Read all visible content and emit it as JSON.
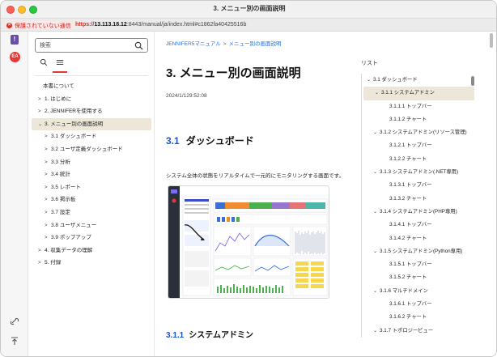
{
  "window": {
    "title": "3. メニュー別の画面説明"
  },
  "urlbar": {
    "security_label": "保護されていない通信",
    "scheme": "https://",
    "host": "13.113.18.12",
    "path": ":8443/manual/ja/index.html#c1862fa40425516b"
  },
  "rail": {
    "warn_glyph": "!",
    "avatar_text": "EA"
  },
  "nav": {
    "search_placeholder": "検索",
    "toc": [
      {
        "label": "本書について",
        "level": "plain",
        "chevron": ""
      },
      {
        "label": "1. はじめに",
        "level": "l0",
        "chevron": ">"
      },
      {
        "label": "2. JENNIFERを使用する",
        "level": "l0",
        "chevron": ">"
      },
      {
        "label": "3. メニュー別の画面説明",
        "level": "l0",
        "chevron": "⌄",
        "active": true
      },
      {
        "label": "3.1 ダッシュボード",
        "level": "l1",
        "chevron": ">"
      },
      {
        "label": "3.2 ユーザ定義ダッシュボード",
        "level": "l1",
        "chevron": ">"
      },
      {
        "label": "3.3 分析",
        "level": "l1",
        "chevron": ">"
      },
      {
        "label": "3.4 統計",
        "level": "l1",
        "chevron": ">"
      },
      {
        "label": "3.5 レポート",
        "level": "l1",
        "chevron": ">"
      },
      {
        "label": "3.6 掲示板",
        "level": "l1",
        "chevron": ">"
      },
      {
        "label": "3.7 設定",
        "level": "l1",
        "chevron": ">"
      },
      {
        "label": "3.8 ユーザメニュー",
        "level": "l1",
        "chevron": ">"
      },
      {
        "label": "3.9 ポップアップ",
        "level": "l1",
        "chevron": ">"
      },
      {
        "label": "4. 収集データの理解",
        "level": "l0",
        "chevron": ">"
      },
      {
        "label": "5. 付録",
        "level": "l0",
        "chevron": ">"
      }
    ]
  },
  "main": {
    "breadcrumb": [
      "JENNIFER5マニュアル",
      "メニュー別の画面説明"
    ],
    "breadcrumb_sep": ">",
    "title": "3.  メニュー別の画面説明",
    "date": "2024/1/129:52:08",
    "section_num": "3.1",
    "section_title": "ダッシュボード",
    "description": "システム全体の状態をリアルタイムで一元的にモニタリングする画面です。",
    "subsection_num": "3.1.1",
    "subsection_title": "システムアドミン"
  },
  "rlist": {
    "title": "リスト",
    "items": [
      {
        "label": "3.1 ダッシュボード",
        "depth": "d0",
        "chevron": "⌄"
      },
      {
        "label": "3.1.1 システムアドミン",
        "depth": "d1",
        "chevron": "⌄",
        "active": true
      },
      {
        "label": "3.1.1.1 トップバー",
        "depth": "d2",
        "chevron": ""
      },
      {
        "label": "3.1.1.2 チャート",
        "depth": "d2",
        "chevron": ""
      },
      {
        "label": "3.1.2 システムアドミン(リソース管理)",
        "depth": "d1",
        "chevron": "⌄"
      },
      {
        "label": "3.1.2.1 トップバー",
        "depth": "d2",
        "chevron": ""
      },
      {
        "label": "3.1.2.2 チャート",
        "depth": "d2",
        "chevron": ""
      },
      {
        "label": "3.1.3 システムアドミン(.NET専用)",
        "depth": "d1",
        "chevron": "⌄"
      },
      {
        "label": "3.1.3.1 トップバー",
        "depth": "d2",
        "chevron": ""
      },
      {
        "label": "3.1.3.2 チャート",
        "depth": "d2",
        "chevron": ""
      },
      {
        "label": "3.1.4 システムアドミン(PHP専用)",
        "depth": "d1",
        "chevron": "⌄"
      },
      {
        "label": "3.1.4.1 トップバー",
        "depth": "d2",
        "chevron": ""
      },
      {
        "label": "3.1.4.2 チャート",
        "depth": "d2",
        "chevron": ""
      },
      {
        "label": "3.1.5 システムアドミン(Python専用)",
        "depth": "d1",
        "chevron": "⌄"
      },
      {
        "label": "3.1.5.1 トップバー",
        "depth": "d2",
        "chevron": ""
      },
      {
        "label": "3.1.5.2 チャート",
        "depth": "d2",
        "chevron": ""
      },
      {
        "label": "3.1.6 マルチドメイン",
        "depth": "d1",
        "chevron": "⌄"
      },
      {
        "label": "3.1.6.1 トップバー",
        "depth": "d2",
        "chevron": ""
      },
      {
        "label": "3.1.6.2 チャート",
        "depth": "d2",
        "chevron": ""
      },
      {
        "label": "3.1.7 トポロジービュー",
        "depth": "d1",
        "chevron": "⌄"
      }
    ]
  },
  "colors": {
    "accent_blue": "#1a56c8",
    "active_bg": "#ece7d8",
    "warn_red": "#d93025",
    "link_blue": "#1a73e8"
  }
}
